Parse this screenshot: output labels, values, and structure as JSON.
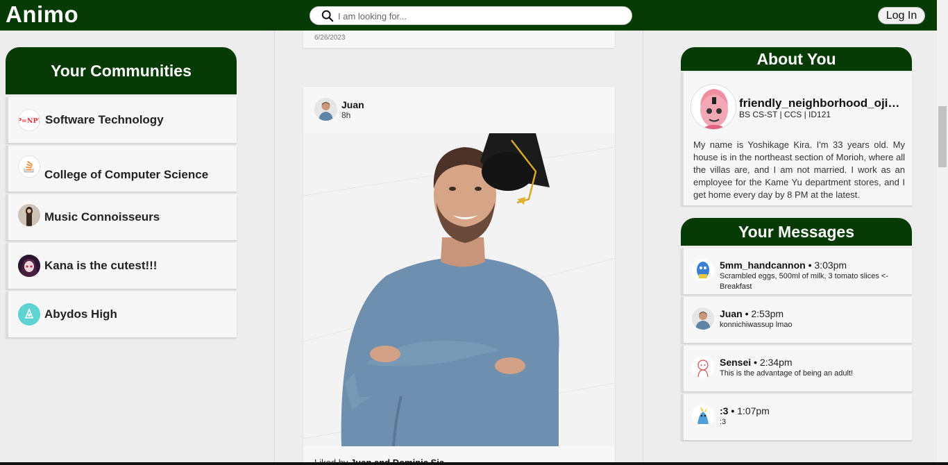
{
  "app": {
    "logo": "Animo"
  },
  "search": {
    "placeholder": "I am looking for..."
  },
  "auth": {
    "login_label": "Log In"
  },
  "communities": {
    "title": "Your Communities",
    "items": [
      {
        "label": "Software Technology",
        "icon": "pnp-icon"
      },
      {
        "label": "College of Computer Science",
        "icon": "stack-overflow-icon"
      },
      {
        "label": "Music Connoisseurs",
        "icon": "music-avatar-icon"
      },
      {
        "label": "Kana is the cutest!!!",
        "icon": "anime-avatar-icon"
      },
      {
        "label": "Abydos High",
        "icon": "abydos-icon"
      }
    ]
  },
  "feed": {
    "previous_post": {
      "date": "6/26/2023"
    },
    "post": {
      "author": "Juan",
      "time": "8h",
      "liked_by_prefix": "Liked by ",
      "liked_by_names": "Juan and Dominic Sia"
    }
  },
  "about": {
    "title": "About You",
    "username": "friendly_neighborhood_ojisan",
    "meta": "BS CS-ST | CCS | ID121",
    "bio": "My name is Yoshikage Kira. I'm 33 years old. My house is in the northeast section of Morioh, where all the villas are, and I am not married. I work as an employee for the Kame Yu department stores, and I get home every day by 8 PM at the latest."
  },
  "messages": {
    "title": "Your Messages",
    "items": [
      {
        "name": "5mm_handcannon",
        "time": "3:03pm",
        "text": "Scrambled eggs, 500ml of milk, 3 tomato slices <-Breakfast"
      },
      {
        "name": "Juan",
        "time": "2:53pm",
        "text": "konnichiwassup lmao"
      },
      {
        "name": "Sensei",
        "time": "2:34pm",
        "text": "This is the advantage of being an adult!"
      },
      {
        "name": ":3",
        "time": "1:07pm",
        "text": ":3"
      }
    ]
  },
  "colors": {
    "brand": "#073b06",
    "background": "#ededed",
    "card": "#f7f7f7"
  }
}
